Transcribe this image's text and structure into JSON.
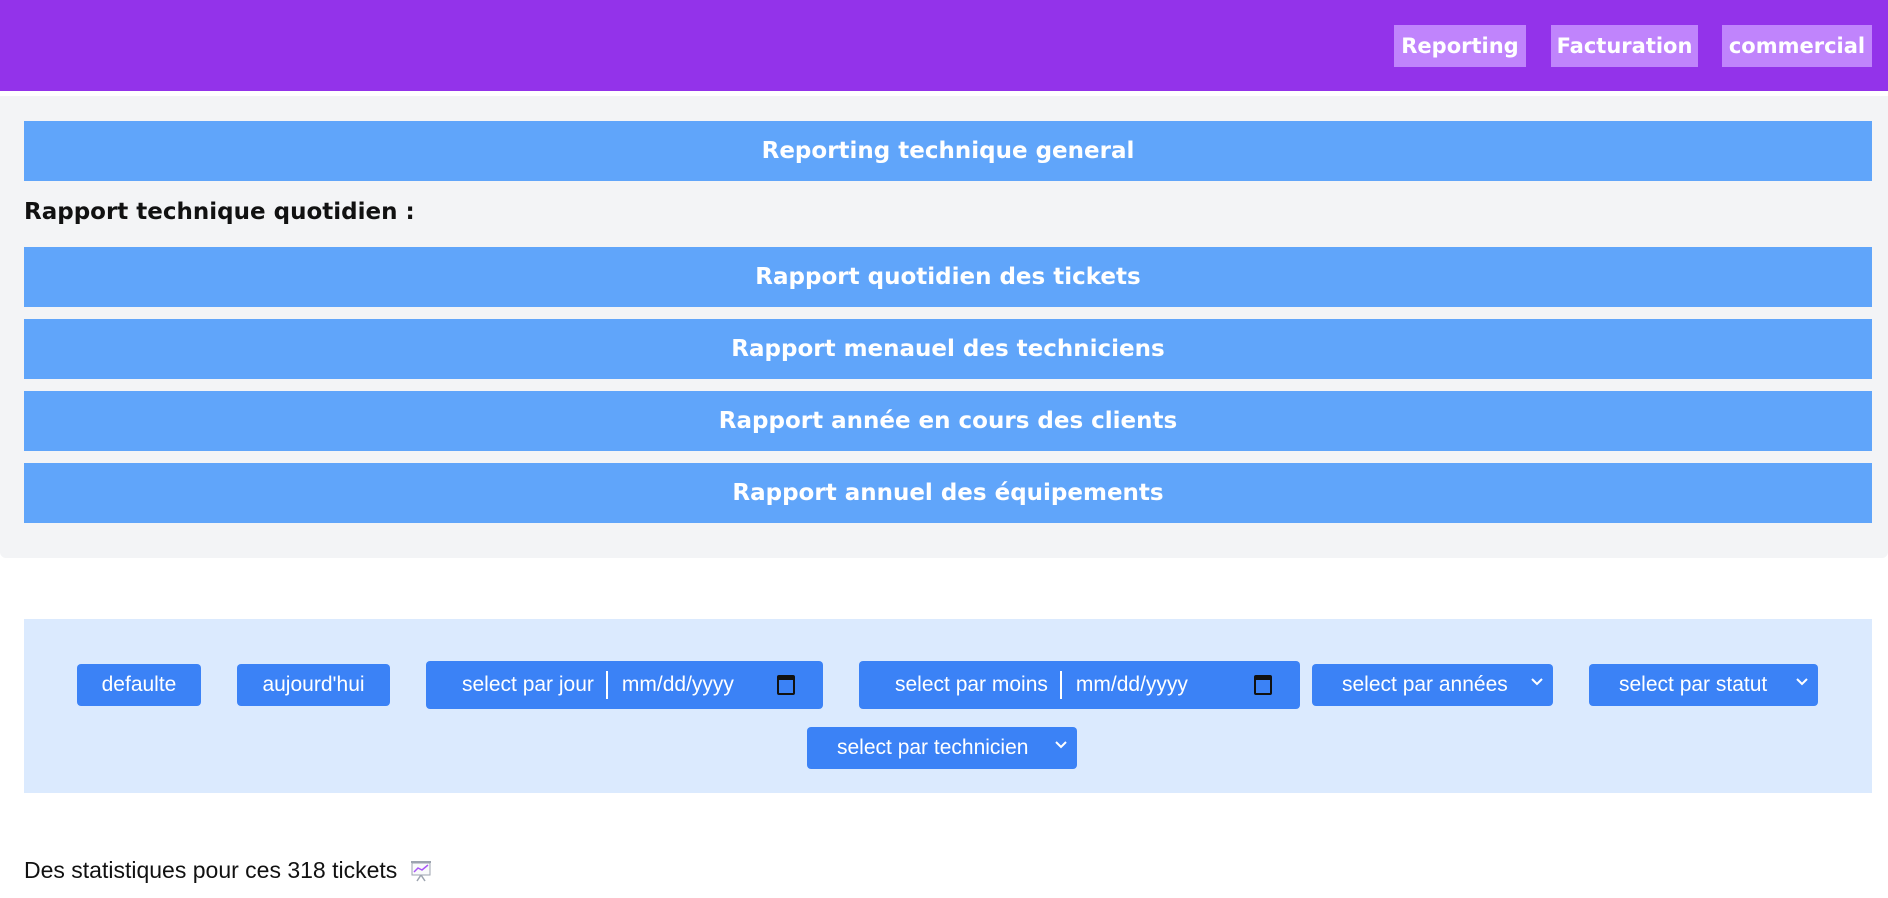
{
  "nav": {
    "items": [
      {
        "label": "Reporting"
      },
      {
        "label": "Facturation"
      },
      {
        "label": "commercial"
      }
    ]
  },
  "reports": {
    "general": "Reporting technique general",
    "section_title": "Rapport technique quotidien :",
    "items": [
      {
        "label": "Rapport quotidien des tickets"
      },
      {
        "label": "Rapport menauel des techniciens"
      },
      {
        "label": "Rapport année en cours des clients"
      },
      {
        "label": "Rapport annuel des équipements"
      }
    ]
  },
  "filters": {
    "default_label": "defaulte",
    "today_label": "aujourd'hui",
    "day": {
      "label": "select par jour",
      "date_placeholder": "mm/dd/yyyy"
    },
    "month": {
      "label": "select par moins",
      "date_placeholder": "mm/dd/yyyy"
    },
    "years_select": "select par années",
    "status_select": "select par statut",
    "technician_select": "select par technicien"
  },
  "stats": {
    "text": "Des statistiques pour ces 318 tickets",
    "icon": "chart-presentation-icon"
  },
  "colors": {
    "topbar": "#9333ea",
    "nav_button": "#c084fc",
    "report_bar": "#60a5fa",
    "filter_panel": "#dbeafe",
    "filter_button": "#3b82f6"
  }
}
